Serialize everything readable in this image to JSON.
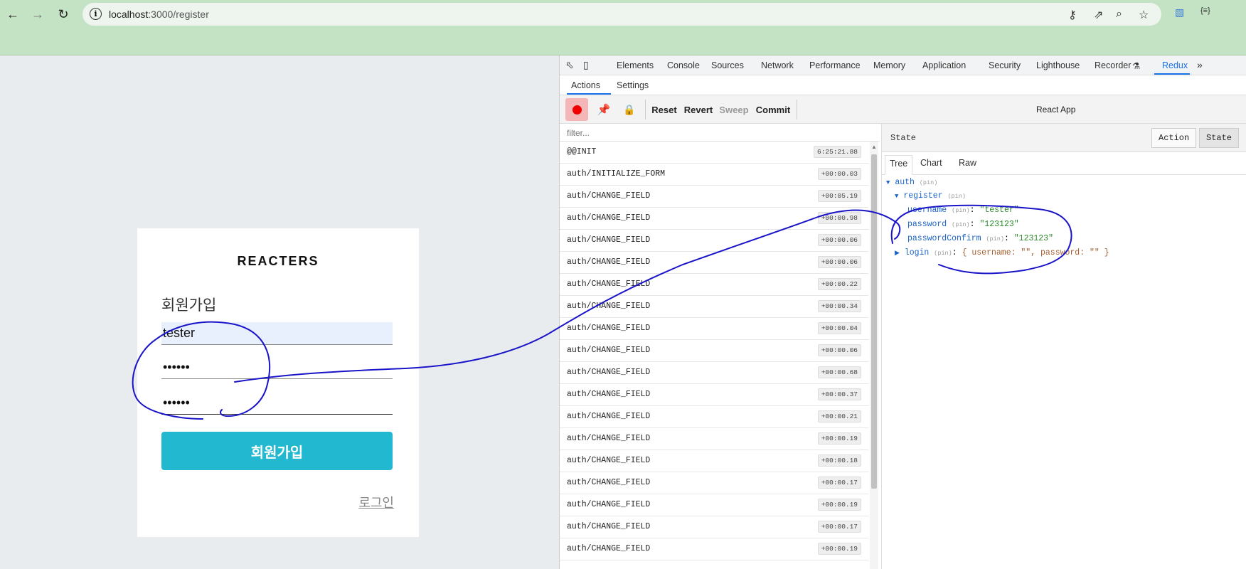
{
  "browser": {
    "url_host": "localhost",
    "url_path": ":3000/register",
    "ext_label": "{≡}"
  },
  "page": {
    "brand": "REACTERS",
    "form_title": "회원가입",
    "username_value": "tester",
    "password_value": "••••••",
    "confirm_value": "••••••",
    "submit_label": "회원가입",
    "login_link": "로그인"
  },
  "devtools": {
    "tabs": [
      "Elements",
      "Console",
      "Sources",
      "Network",
      "Performance",
      "Memory",
      "Application",
      "Security",
      "Lighthouse",
      "Recorder",
      "Redux"
    ],
    "recorder_suffix": "⚗",
    "subtabs": [
      "Actions",
      "Settings"
    ],
    "toolbar": {
      "reset": "Reset",
      "revert": "Revert",
      "sweep": "Sweep",
      "commit": "Commit",
      "instance": "React App"
    },
    "filter_placeholder": "filter...",
    "actions": [
      {
        "name": "@@INIT",
        "time": "6:25:21.88"
      },
      {
        "name": "auth/INITIALIZE_FORM",
        "time": "+00:00.03"
      },
      {
        "name": "auth/CHANGE_FIELD",
        "time": "+00:05.19"
      },
      {
        "name": "auth/CHANGE_FIELD",
        "time": "+00:00.98"
      },
      {
        "name": "auth/CHANGE_FIELD",
        "time": "+00:00.06"
      },
      {
        "name": "auth/CHANGE_FIELD",
        "time": "+00:00.06"
      },
      {
        "name": "auth/CHANGE_FIELD",
        "time": "+00:00.22"
      },
      {
        "name": "auth/CHANGE_FIELD",
        "time": "+00:00.34"
      },
      {
        "name": "auth/CHANGE_FIELD",
        "time": "+00:00.04"
      },
      {
        "name": "auth/CHANGE_FIELD",
        "time": "+00:00.06"
      },
      {
        "name": "auth/CHANGE_FIELD",
        "time": "+00:00.68"
      },
      {
        "name": "auth/CHANGE_FIELD",
        "time": "+00:00.37"
      },
      {
        "name": "auth/CHANGE_FIELD",
        "time": "+00:00.21"
      },
      {
        "name": "auth/CHANGE_FIELD",
        "time": "+00:00.19"
      },
      {
        "name": "auth/CHANGE_FIELD",
        "time": "+00:00.18"
      },
      {
        "name": "auth/CHANGE_FIELD",
        "time": "+00:00.17"
      },
      {
        "name": "auth/CHANGE_FIELD",
        "time": "+00:00.19"
      },
      {
        "name": "auth/CHANGE_FIELD",
        "time": "+00:00.17"
      },
      {
        "name": "auth/CHANGE_FIELD",
        "time": "+00:00.19"
      }
    ],
    "state_panel": {
      "title": "State",
      "modes": [
        "Action",
        "State"
      ],
      "views": [
        "Tree",
        "Chart",
        "Raw"
      ],
      "pin": "(pin)",
      "tree": {
        "auth_key": "auth",
        "register_key": "register",
        "username_key": "username",
        "username_val": "\"tester\"",
        "password_key": "password",
        "password_val": "\"123123\"",
        "confirm_key": "passwordConfirm",
        "confirm_val": "\"123123\"",
        "login_key": "login",
        "login_summary": "{ username: \"\", password: \"\" }"
      }
    }
  },
  "colors": {
    "annotation": "#1a14c9",
    "accent": "#22b8cf",
    "devtools_active": "#1a73e8"
  }
}
